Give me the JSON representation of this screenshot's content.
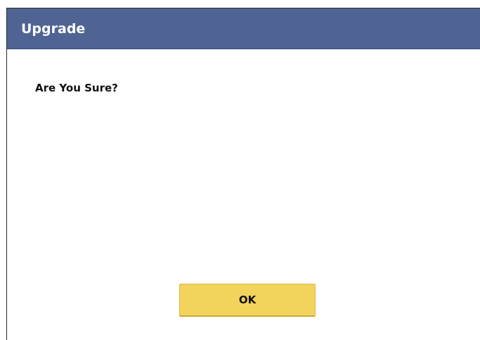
{
  "dialog": {
    "title": "Upgrade",
    "message": "Are You Sure?",
    "ok_label": "OK"
  },
  "colors": {
    "titlebar": "#4f6492",
    "button": "#f2d35c"
  }
}
